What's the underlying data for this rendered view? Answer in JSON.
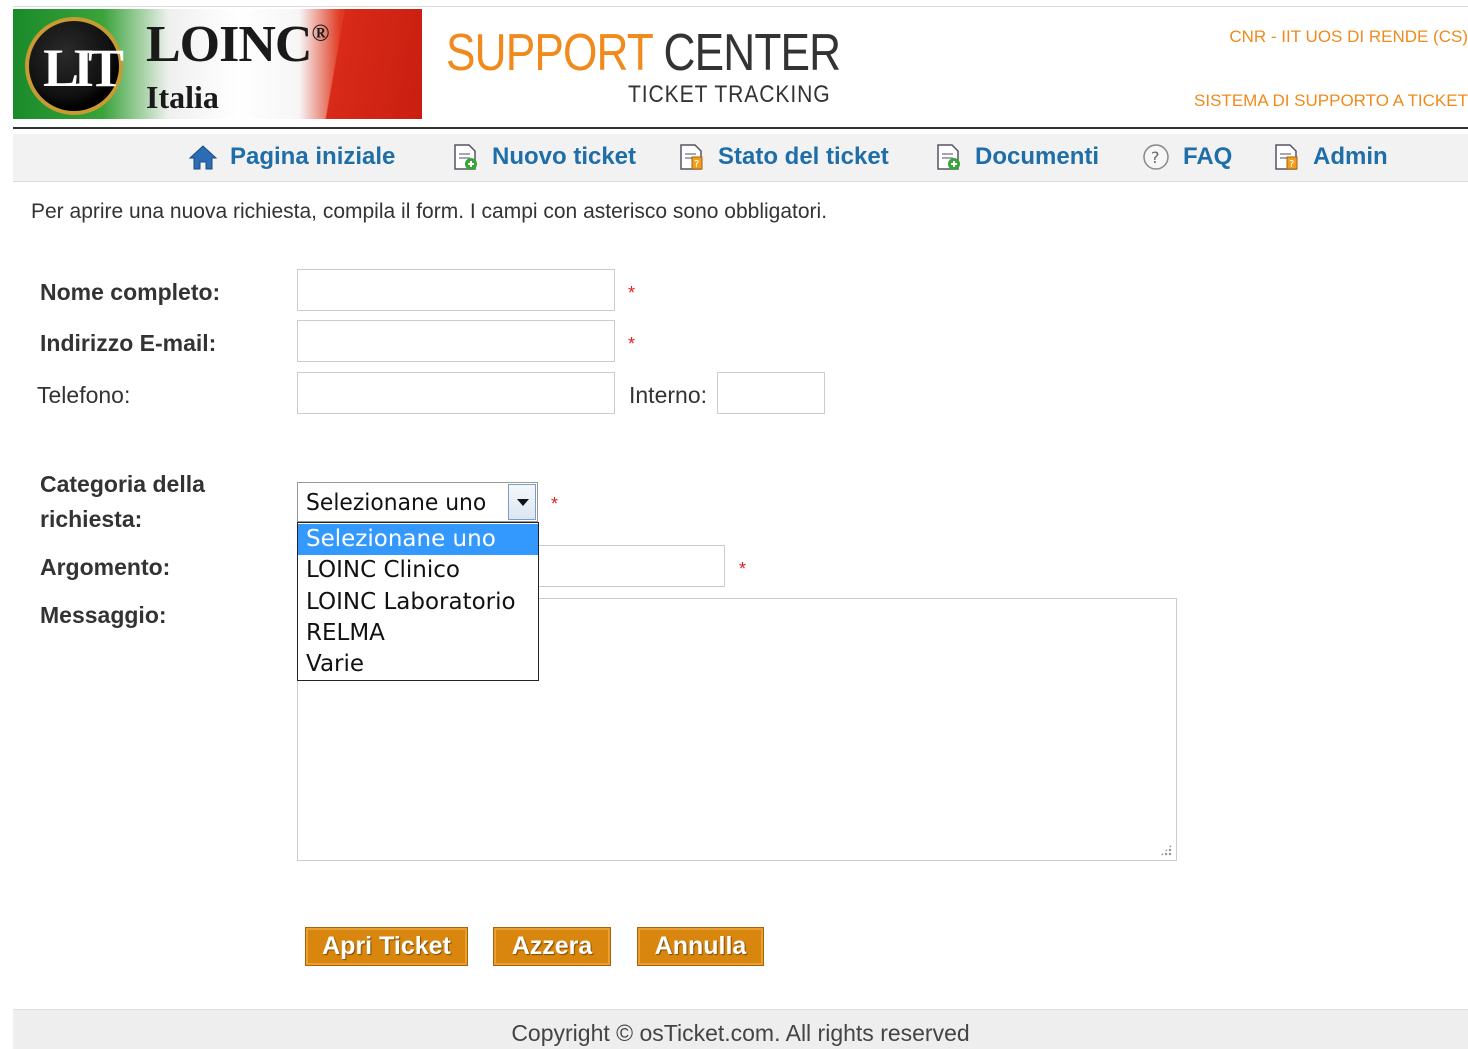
{
  "header": {
    "logo_brand": "LOINC",
    "logo_reg": "®",
    "logo_sub": "Italia",
    "logo_emblem": "LIT",
    "support_word1": "SUPPORT",
    "support_word2": "CENTER",
    "tracking": "TICKET TRACKING",
    "org": "CNR - IIT UOS DI RENDE (CS)",
    "system": "SISTEMA DI SUPPORTO A TICKET"
  },
  "nav": [
    {
      "label": "Pagina iniziale",
      "icon": "home-icon"
    },
    {
      "label": "Nuovo ticket",
      "icon": "new-ticket-icon"
    },
    {
      "label": "Stato del ticket",
      "icon": "ticket-status-icon"
    },
    {
      "label": "Documenti",
      "icon": "documents-icon"
    },
    {
      "label": "FAQ",
      "icon": "help-icon"
    },
    {
      "label": "Admin",
      "icon": "admin-icon"
    }
  ],
  "intro": "Per aprire una nuova richiesta, compila il form. I campi con asterisco sono obbligatori.",
  "form": {
    "name_label": "Nome completo:",
    "name_value": "",
    "email_label": "Indirizzo E-mail:",
    "email_value": "",
    "phone_label": "Telefono:",
    "phone_value": "",
    "ext_label": "Interno:",
    "ext_value": "",
    "category_label_line1": "Categoria della",
    "category_label_line2": "richiesta:",
    "category_selected": "Selezionane uno",
    "category_options": [
      "Selezionane uno",
      "LOINC Clinico",
      "LOINC Laboratorio",
      "RELMA",
      "Varie"
    ],
    "subject_label": "Argomento:",
    "subject_value": "",
    "message_label": "Messaggio:",
    "message_value": "",
    "required_mark": "*"
  },
  "buttons": {
    "open": "Apri Ticket",
    "reset": "Azzera",
    "cancel": "Annulla"
  },
  "footer": "Copyright © osTicket.com. All rights reserved",
  "colors": {
    "accent_orange": "#f08a1c",
    "button_orange": "#d9860e",
    "nav_link": "#1f6ea8",
    "selected_option": "#3399ff",
    "required": "#e02020"
  }
}
